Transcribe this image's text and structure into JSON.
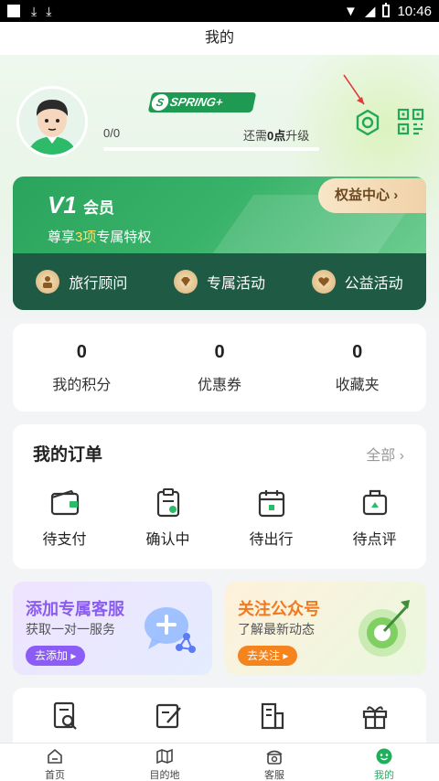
{
  "status_bar": {
    "time": "10:46"
  },
  "title": "我的",
  "profile": {
    "brand": "SPRING+",
    "progress": "0/0",
    "upgrade_prefix": "还需",
    "upgrade_points": "0点",
    "upgrade_suffix": "升级",
    "progress_fraction": 0
  },
  "vip": {
    "title": "V1",
    "title_suffix": "会员",
    "subtitle_prefix": "尊享",
    "subtitle_highlight": "3项",
    "subtitle_suffix": "专属特权",
    "benefit_button": "权益中心",
    "items": [
      {
        "label": "旅行顾问",
        "icon": "advisor-icon"
      },
      {
        "label": "专属活动",
        "icon": "diamond-icon"
      },
      {
        "label": "公益活动",
        "icon": "heart-icon"
      }
    ]
  },
  "stats": [
    {
      "value": "0",
      "label": "我的积分"
    },
    {
      "value": "0",
      "label": "优惠券"
    },
    {
      "value": "0",
      "label": "收藏夹"
    }
  ],
  "orders": {
    "title": "我的订单",
    "all": "全部",
    "items": [
      {
        "label": "待支付",
        "icon": "wallet-icon"
      },
      {
        "label": "确认中",
        "icon": "clipboard-icon"
      },
      {
        "label": "待出行",
        "icon": "calendar-icon"
      },
      {
        "label": "待点评",
        "icon": "luggage-icon"
      }
    ]
  },
  "promos": [
    {
      "title": "添加专属客服",
      "subtitle": "获取一对一服务",
      "button": "去添加"
    },
    {
      "title": "关注公众号",
      "subtitle": "了解最新动态",
      "button": "去关注"
    }
  ],
  "tools": [
    {
      "icon": "document-search-icon"
    },
    {
      "icon": "edit-note-icon"
    },
    {
      "icon": "building-icon"
    },
    {
      "icon": "gift-icon"
    }
  ],
  "tabs": [
    {
      "label": "首页",
      "icon": "home-icon"
    },
    {
      "label": "目的地",
      "icon": "map-icon"
    },
    {
      "label": "客服",
      "icon": "phone-icon"
    },
    {
      "label": "我的",
      "icon": "profile-icon",
      "active": true
    }
  ],
  "colors": {
    "accent": "#1fb05c",
    "vip_green": "#2aa35c",
    "vip_dark": "#1f5a45"
  }
}
